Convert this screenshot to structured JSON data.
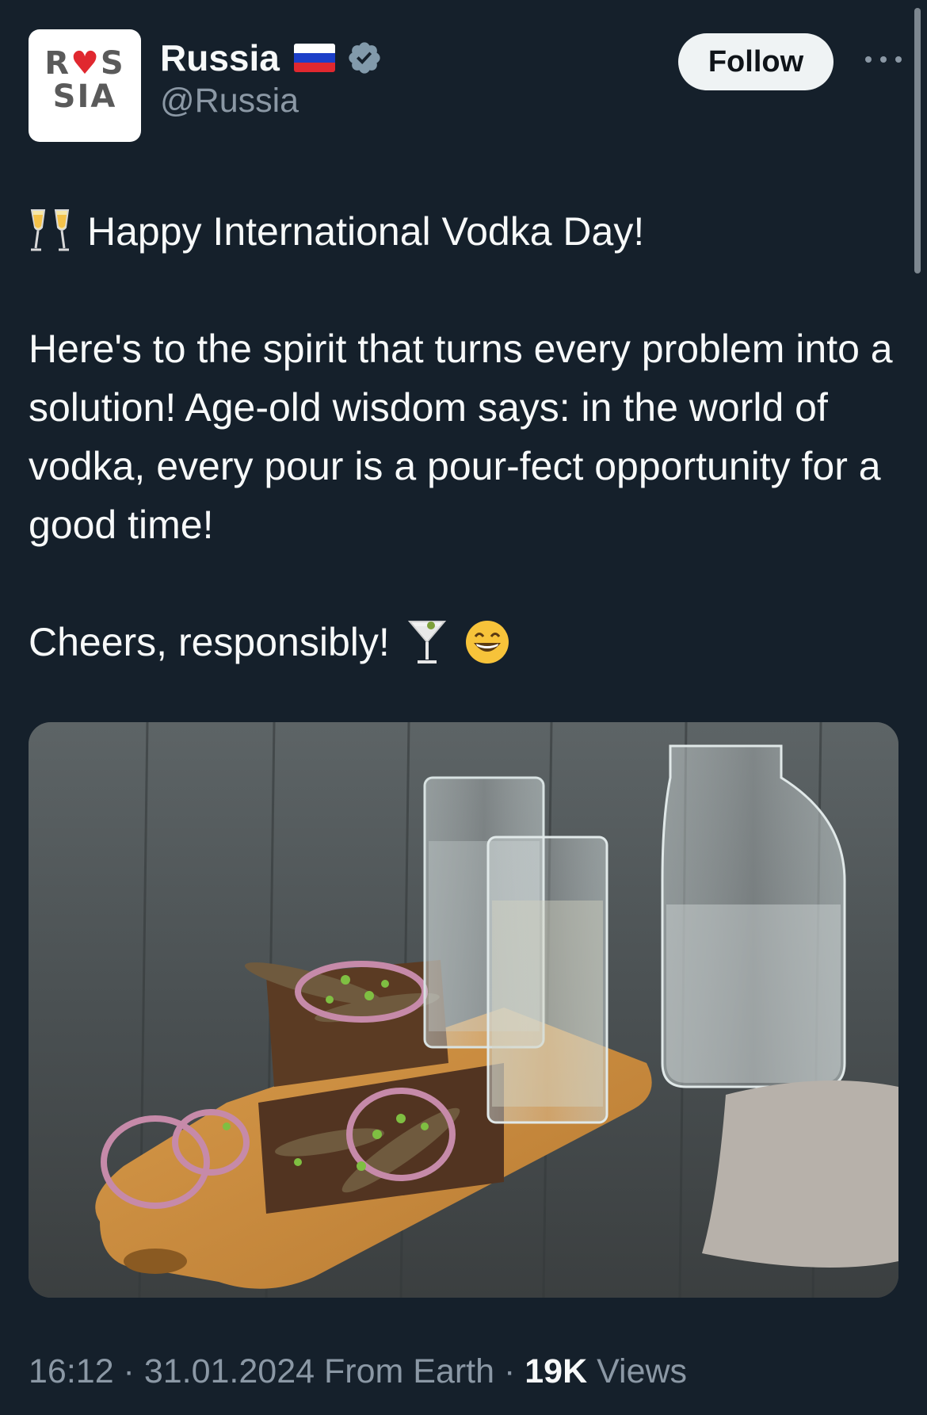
{
  "author": {
    "display_name": "Russia",
    "handle": "@Russia",
    "avatar_text_line1": "R♥S",
    "avatar_text_line2": "SIA",
    "flag_colors": [
      "#ffffff",
      "#1c3fc8",
      "#e0282f"
    ]
  },
  "actions": {
    "follow_label": "Follow",
    "more_icon": "more-horizontal-icon"
  },
  "tweet": {
    "line1": "Happy International Vodka Day!",
    "paragraph2": "Here's to the spirit that turns every problem into a solution! Age-old wisdom says: in the world of vodka, every pour is a pour-fect opportunity for a good time!",
    "paragraph3": "Cheers, responsibly!",
    "emojis": [
      "clinking-glasses-icon",
      "cocktail-glass-icon",
      "grinning-face-icon"
    ]
  },
  "meta": {
    "time": "16:12",
    "separator": " · ",
    "date": "31.01.2024",
    "source": "From Earth",
    "views_count": "19K",
    "views_label": "Views"
  },
  "colors": {
    "background": "#15202b",
    "text": "#f7f9f9",
    "secondary": "#8b98a5",
    "follow_bg": "#eff3f4",
    "verified": "#829aab"
  }
}
